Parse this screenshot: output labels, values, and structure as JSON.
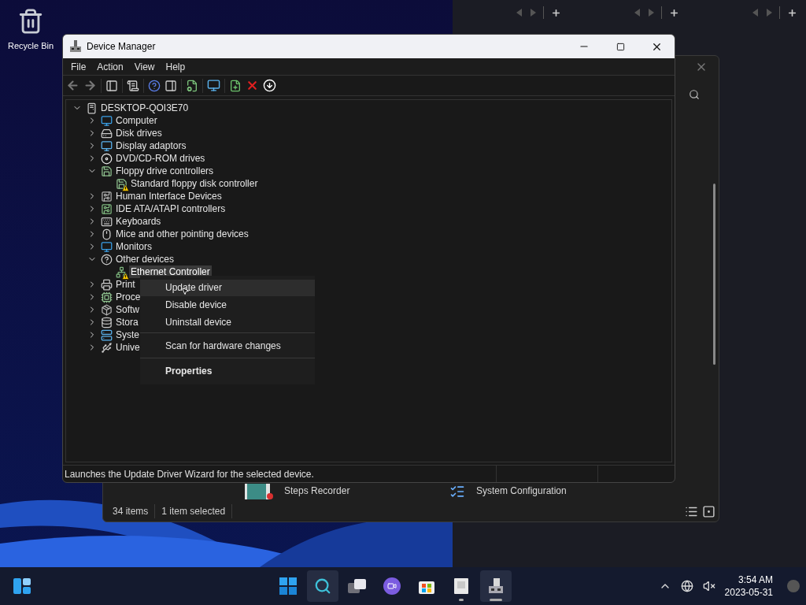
{
  "desktop": {
    "icons": [
      {
        "label": "Recycle Bin"
      }
    ]
  },
  "background_window": {
    "items": [
      {
        "label": "Steps Recorder",
        "kind": "recorder"
      },
      {
        "label": "System Configuration",
        "kind": "config"
      }
    ],
    "status_count": "34 items",
    "status_selection": "1 item selected"
  },
  "device_manager": {
    "title": "Device Manager",
    "menu": [
      {
        "label": "File"
      },
      {
        "label": "Action"
      },
      {
        "label": "View"
      },
      {
        "label": "Help"
      }
    ],
    "tree": {
      "label": "DESKTOP-QOI3E70",
      "kind": "root",
      "expanded": true,
      "selected": false,
      "children": [
        {
          "label": "Computer",
          "kind": "computer",
          "expanded": false,
          "selected": false
        },
        {
          "label": "Disk drives",
          "kind": "disk",
          "expanded": false,
          "selected": false
        },
        {
          "label": "Display adaptors",
          "kind": "display",
          "expanded": false,
          "selected": false
        },
        {
          "label": "DVD/CD-ROM drives",
          "kind": "dvd",
          "expanded": false,
          "selected": false
        },
        {
          "label": "Floppy drive controllers",
          "kind": "floppy",
          "expanded": true,
          "selected": false,
          "children": [
            {
              "label": "Standard floppy disk controller",
              "kind": "floppy",
              "warning": true,
              "selected": false
            }
          ]
        },
        {
          "label": "Human Interface Devices",
          "kind": "hid",
          "expanded": false,
          "selected": false
        },
        {
          "label": "IDE ATA/ATAPI controllers",
          "kind": "ide",
          "expanded": false,
          "selected": false
        },
        {
          "label": "Keyboards",
          "kind": "keyboard",
          "expanded": false,
          "selected": false
        },
        {
          "label": "Mice and other pointing devices",
          "kind": "mouse",
          "expanded": false,
          "selected": false
        },
        {
          "label": "Monitors",
          "kind": "monitor",
          "expanded": false,
          "selected": false
        },
        {
          "label": "Other devices",
          "kind": "other",
          "expanded": true,
          "selected": false,
          "children": [
            {
              "label": "Ethernet Controller",
              "kind": "network",
              "warning": true,
              "selected": true
            }
          ]
        },
        {
          "label": "Print",
          "kind": "printer",
          "expanded": false,
          "selected": false
        },
        {
          "label": "Proce",
          "kind": "processor",
          "expanded": false,
          "selected": false
        },
        {
          "label": "Softw",
          "kind": "software",
          "expanded": false,
          "selected": false
        },
        {
          "label": "Stora",
          "kind": "storage",
          "expanded": false,
          "selected": false
        },
        {
          "label": "Syste",
          "kind": "system",
          "expanded": false,
          "selected": false
        },
        {
          "label": "Unive",
          "kind": "usb",
          "expanded": false,
          "selected": false
        }
      ]
    },
    "status_bar": "Launches the Update Driver Wizard for the selected device."
  },
  "context_menu": {
    "groups": [
      [
        {
          "label": "Update driver",
          "selected": true,
          "default": false
        },
        {
          "label": "Disable device",
          "selected": false,
          "default": false
        },
        {
          "label": "Uninstall device",
          "selected": false,
          "default": false
        }
      ],
      [
        {
          "label": "Scan for hardware changes",
          "selected": false,
          "default": false
        }
      ],
      [
        {
          "label": "Properties",
          "selected": false,
          "default": true
        }
      ]
    ]
  },
  "taskbar": {
    "apps": [
      {
        "kind": "start",
        "highlighted": false,
        "running": false,
        "active": false
      },
      {
        "kind": "search",
        "highlighted": true,
        "running": false,
        "active": false
      },
      {
        "kind": "task_view",
        "highlighted": false,
        "running": false,
        "active": false
      },
      {
        "kind": "chat",
        "highlighted": false,
        "running": false,
        "active": false
      },
      {
        "kind": "store",
        "highlighted": false,
        "running": false,
        "active": false
      },
      {
        "kind": "notepad",
        "highlighted": false,
        "running": true,
        "active": false
      },
      {
        "kind": "device_manager",
        "highlighted": true,
        "running": true,
        "active": true
      }
    ],
    "time": "3:54 AM",
    "date": "2023-05-31"
  }
}
